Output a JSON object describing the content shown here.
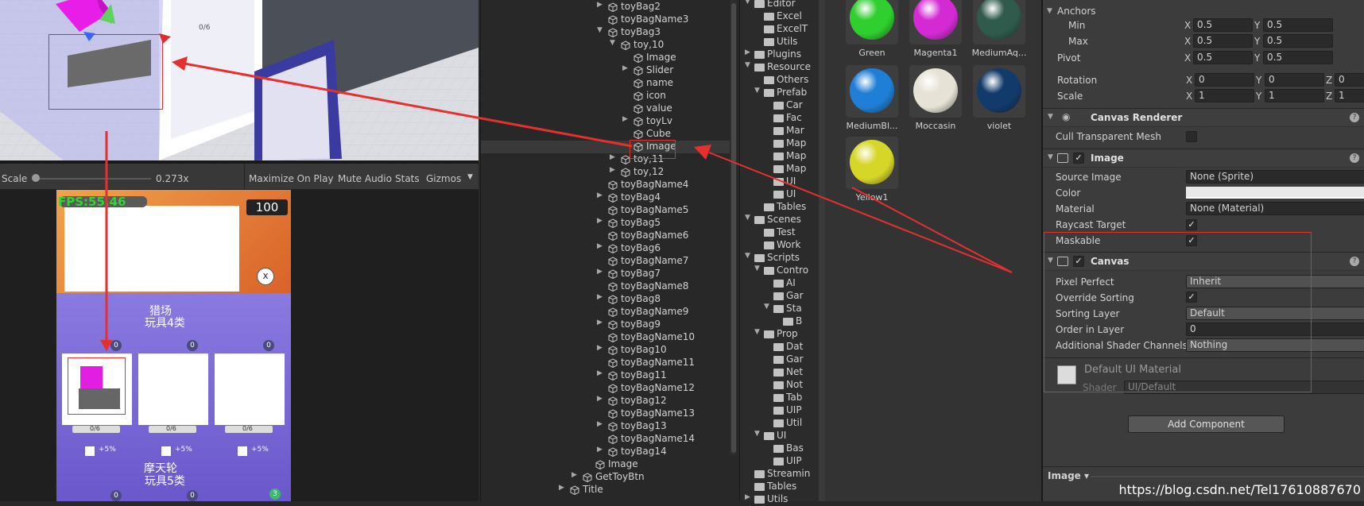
{
  "game_toolbar": {
    "scale_label": "Scale",
    "scale_value": "0.273x",
    "maximize_on_play": "Maximize On Play",
    "mute_audio": "Mute Audio",
    "stats": "Stats",
    "gizmos": "Gizmos"
  },
  "scene_labels": {
    "tag": "0/6"
  },
  "game": {
    "fps": "FPS:55.46",
    "score": "100",
    "close": "x",
    "section1_title": "猎场",
    "section1_sub": "玩具4类",
    "section2_title": "摩天轮",
    "section2_sub": "玩具5类",
    "card_count": "0/6",
    "card_bonus": "+5%",
    "badge": "0",
    "badge_green": "3"
  },
  "hierarchy": {
    "items": [
      {
        "label": "toyBag2",
        "indent": 0,
        "arrow": "▶"
      },
      {
        "label": "toyBagName3",
        "indent": 0,
        "arrow": ""
      },
      {
        "label": "toyBag3",
        "indent": 0,
        "arrow": "▼"
      },
      {
        "label": "toy,10",
        "indent": 1,
        "arrow": "▼"
      },
      {
        "label": "Image",
        "indent": 2,
        "arrow": ""
      },
      {
        "label": "Slider",
        "indent": 2,
        "arrow": "▶"
      },
      {
        "label": "name",
        "indent": 2,
        "arrow": ""
      },
      {
        "label": "icon",
        "indent": 2,
        "arrow": ""
      },
      {
        "label": "value",
        "indent": 2,
        "arrow": ""
      },
      {
        "label": "toyLv",
        "indent": 2,
        "arrow": "▶"
      },
      {
        "label": "Cube",
        "indent": 2,
        "arrow": ""
      },
      {
        "label": "Image",
        "indent": 2,
        "arrow": ""
      },
      {
        "label": "toy,11",
        "indent": 1,
        "arrow": "▶"
      },
      {
        "label": "toy,12",
        "indent": 1,
        "arrow": "▶"
      },
      {
        "label": "toyBagName4",
        "indent": 0,
        "arrow": ""
      },
      {
        "label": "toyBag4",
        "indent": 0,
        "arrow": "▶"
      },
      {
        "label": "toyBagName5",
        "indent": 0,
        "arrow": ""
      },
      {
        "label": "toyBag5",
        "indent": 0,
        "arrow": "▶"
      },
      {
        "label": "toyBagName6",
        "indent": 0,
        "arrow": ""
      },
      {
        "label": "toyBag6",
        "indent": 0,
        "arrow": "▶"
      },
      {
        "label": "toyBagName7",
        "indent": 0,
        "arrow": ""
      },
      {
        "label": "toyBag7",
        "indent": 0,
        "arrow": "▶"
      },
      {
        "label": "toyBagName8",
        "indent": 0,
        "arrow": ""
      },
      {
        "label": "toyBag8",
        "indent": 0,
        "arrow": "▶"
      },
      {
        "label": "toyBagName9",
        "indent": 0,
        "arrow": ""
      },
      {
        "label": "toyBag9",
        "indent": 0,
        "arrow": "▶"
      },
      {
        "label": "toyBagName10",
        "indent": 0,
        "arrow": ""
      },
      {
        "label": "toyBag10",
        "indent": 0,
        "arrow": "▶"
      },
      {
        "label": "toyBagName11",
        "indent": 0,
        "arrow": ""
      },
      {
        "label": "toyBag11",
        "indent": 0,
        "arrow": "▶"
      },
      {
        "label": "toyBagName12",
        "indent": 0,
        "arrow": ""
      },
      {
        "label": "toyBag12",
        "indent": 0,
        "arrow": "▶"
      },
      {
        "label": "toyBagName13",
        "indent": 0,
        "arrow": ""
      },
      {
        "label": "toyBag13",
        "indent": 0,
        "arrow": "▶"
      },
      {
        "label": "toyBagName14",
        "indent": 0,
        "arrow": ""
      },
      {
        "label": "toyBag14",
        "indent": 0,
        "arrow": "▶"
      },
      {
        "label": "Image",
        "indent": -1,
        "arrow": ""
      },
      {
        "label": "GetToyBtn",
        "indent": -2,
        "arrow": "▶"
      },
      {
        "label": "Title",
        "indent": -3,
        "arrow": "▶"
      }
    ]
  },
  "project": {
    "items": [
      {
        "label": "Editor",
        "indent": 0,
        "arrow": "▼"
      },
      {
        "label": "Excel",
        "indent": 1,
        "arrow": ""
      },
      {
        "label": "ExcelT",
        "indent": 1,
        "arrow": ""
      },
      {
        "label": "Utils",
        "indent": 1,
        "arrow": ""
      },
      {
        "label": "Plugins",
        "indent": 0,
        "arrow": "▶"
      },
      {
        "label": "Resource",
        "indent": 0,
        "arrow": "▼"
      },
      {
        "label": "Others",
        "indent": 1,
        "arrow": ""
      },
      {
        "label": "Prefab",
        "indent": 1,
        "arrow": "▼"
      },
      {
        "label": "Car",
        "indent": 2,
        "arrow": ""
      },
      {
        "label": "Fac",
        "indent": 2,
        "arrow": ""
      },
      {
        "label": "Mar",
        "indent": 2,
        "arrow": ""
      },
      {
        "label": "Map",
        "indent": 2,
        "arrow": ""
      },
      {
        "label": "Map",
        "indent": 2,
        "arrow": ""
      },
      {
        "label": "Map",
        "indent": 2,
        "arrow": ""
      },
      {
        "label": "UI",
        "indent": 2,
        "arrow": ""
      },
      {
        "label": "UI",
        "indent": 2,
        "arrow": ""
      },
      {
        "label": "Tables",
        "indent": 1,
        "arrow": ""
      },
      {
        "label": "Scenes",
        "indent": 0,
        "arrow": "▼"
      },
      {
        "label": "Test",
        "indent": 1,
        "arrow": ""
      },
      {
        "label": "Work",
        "indent": 1,
        "arrow": ""
      },
      {
        "label": "Scripts",
        "indent": 0,
        "arrow": "▼"
      },
      {
        "label": "Contro",
        "indent": 1,
        "arrow": "▼"
      },
      {
        "label": "AI",
        "indent": 2,
        "arrow": ""
      },
      {
        "label": "Gar",
        "indent": 2,
        "arrow": ""
      },
      {
        "label": "Sta",
        "indent": 2,
        "arrow": "▼"
      },
      {
        "label": "B",
        "indent": 3,
        "arrow": ""
      },
      {
        "label": "Prop",
        "indent": 1,
        "arrow": "▼"
      },
      {
        "label": "Dat",
        "indent": 2,
        "arrow": ""
      },
      {
        "label": "Gar",
        "indent": 2,
        "arrow": ""
      },
      {
        "label": "Net",
        "indent": 2,
        "arrow": ""
      },
      {
        "label": "Not",
        "indent": 2,
        "arrow": ""
      },
      {
        "label": "Tab",
        "indent": 2,
        "arrow": ""
      },
      {
        "label": "UIP",
        "indent": 2,
        "arrow": ""
      },
      {
        "label": "Util",
        "indent": 2,
        "arrow": ""
      },
      {
        "label": "UI",
        "indent": 1,
        "arrow": "▼"
      },
      {
        "label": "Bas",
        "indent": 2,
        "arrow": ""
      },
      {
        "label": "UIP",
        "indent": 2,
        "arrow": ""
      },
      {
        "label": "Streamin",
        "indent": 0,
        "arrow": ""
      },
      {
        "label": "Tables",
        "indent": 0,
        "arrow": ""
      },
      {
        "label": "Utils",
        "indent": 0,
        "arrow": "▶"
      }
    ]
  },
  "assets": {
    "materials": [
      {
        "name": "Green",
        "color": "#2ecf2e"
      },
      {
        "name": "Magenta1",
        "color": "#d42ad4"
      },
      {
        "name": "MediumAq...",
        "color": "#2f5a4c"
      },
      {
        "name": "MediumBl...",
        "color": "#1f7fd6"
      },
      {
        "name": "Moccasin",
        "color": "#e6e2d6"
      },
      {
        "name": "violet",
        "color": "#123a6a"
      },
      {
        "name": "Yellow1",
        "color": "#d6d629"
      }
    ]
  },
  "inspector": {
    "anchors": "Anchors",
    "min": "Min",
    "max": "Max",
    "pivot": "Pivot",
    "rotation": "Rotation",
    "scale": "Scale",
    "x": "X",
    "y": "Y",
    "z": "Z",
    "min_x": "0.5",
    "min_y": "0.5",
    "max_x": "0.5",
    "max_y": "0.5",
    "pivot_x": "0.5",
    "pivot_y": "0.5",
    "rot_x": "0",
    "rot_y": "0",
    "rot_z": "0",
    "scale_x": "1",
    "scale_y": "1",
    "scale_z": "1",
    "canvas_renderer": "Canvas Renderer",
    "cull_transparent_mesh": "Cull Transparent Mesh",
    "image": "Image",
    "source_image": "Source Image",
    "source_image_value": "None (Sprite)",
    "color": "Color",
    "material": "Material",
    "material_value": "None (Material)",
    "raycast_target": "Raycast Target",
    "maskable": "Maskable",
    "canvas": "Canvas",
    "pixel_perfect": "Pixel Perfect",
    "pixel_perfect_value": "Inherit",
    "override_sorting": "Override Sorting",
    "sorting_layer": "Sorting Layer",
    "sorting_layer_value": "Default",
    "order_in_layer": "Order in Layer",
    "order_in_layer_value": "0",
    "additional_shader_channels": "Additional Shader Channels",
    "additional_shader_channels_value": "Nothing",
    "default_ui_material": "Default UI Material",
    "shader": "Shader",
    "shader_value": "UI/Default",
    "add_component": "Add Component",
    "footer_dropdown": "Image ▾",
    "check": "✓"
  },
  "watermark": "https://blog.csdn.net/Tel17610887670"
}
